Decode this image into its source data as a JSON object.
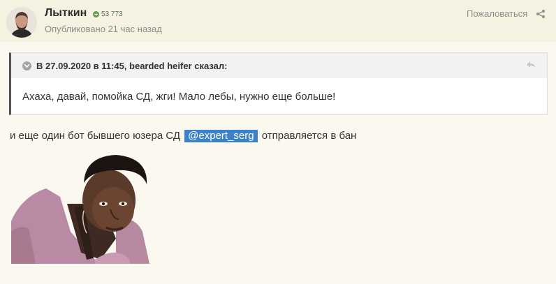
{
  "post": {
    "author": "Лыткин",
    "reputation": "53 773",
    "published": "Опубликовано 21 час назад",
    "report_label": "Пожаловаться"
  },
  "quote": {
    "citation": "В 27.09.2020 в 11:45, bearded heifer сказал:",
    "body": "Ахаха, давай, помойка СД, жги! Мало лебы, нужно еще больше!"
  },
  "message": {
    "text_before": "и еще один бот бывшего юзера СД",
    "mention": "@expert_serg",
    "text_after": "отправляется в бан"
  },
  "icons": {
    "reputation": "plus-circle-icon",
    "share": "share-icon",
    "quote_toggle": "chevron-down-icon",
    "quote_reply": "reply-arrow-icon"
  },
  "colors": {
    "mention_bg": "#3c82c6",
    "header_bg": "#f5f2e1",
    "page_bg": "#fbf8f0",
    "rep_green": "#5f9a4d"
  }
}
